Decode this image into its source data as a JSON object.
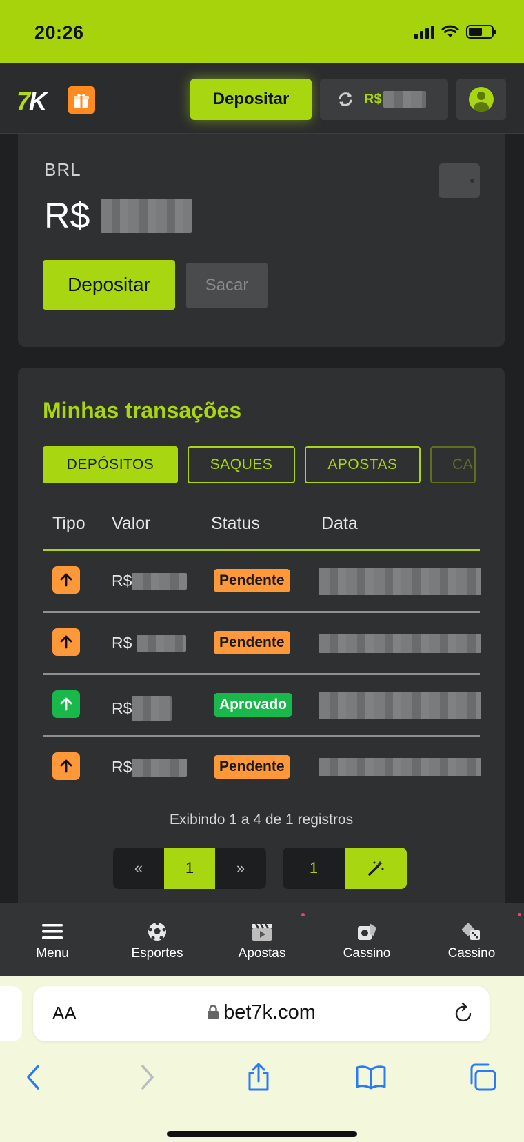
{
  "status": {
    "time": "20:26"
  },
  "header": {
    "logo_seven": "7",
    "logo_k": "K",
    "deposit_label": "Depositar",
    "balance_currency": "R$"
  },
  "wallet": {
    "currency": "BRL",
    "amount_prefix": "R$",
    "deposit_label": "Depositar",
    "withdraw_label": "Sacar"
  },
  "transactions": {
    "title": "Minhas transações",
    "tabs": [
      "DEPÓSITOS",
      "SAQUES",
      "APOSTAS",
      "CA"
    ],
    "columns": [
      "Tipo",
      "Valor",
      "Status",
      "Data"
    ],
    "rows": [
      {
        "value_prefix": "R$",
        "status": "Pendente"
      },
      {
        "value_prefix": "R$ ",
        "status": "Pendente"
      },
      {
        "value_prefix": "R$",
        "status": "Aprovado"
      },
      {
        "value_prefix": "R$",
        "status": "Pendente"
      }
    ],
    "records": "Exibindo 1 a 4 de 1 registros",
    "pager": {
      "first": "«",
      "current": "1",
      "last": "»",
      "page_input": "1"
    }
  },
  "bottom_nav": [
    {
      "label": "Menu",
      "icon": "menu-icon"
    },
    {
      "label": "Esportes",
      "icon": "soccer-ball-icon"
    },
    {
      "label": "Apostas",
      "icon": "clapperboard-icon"
    },
    {
      "label": "Cassino",
      "icon": "poker-chip-icon"
    },
    {
      "label": "Cassino",
      "icon": "dice-icon"
    }
  ],
  "browser": {
    "text_size": "AA",
    "url": "bet7k.com"
  },
  "colors": {
    "accent": "#a8d711",
    "pending": "#ff9838",
    "approved": "#19b84b",
    "background": "#1f2021",
    "card": "#2f3031"
  }
}
